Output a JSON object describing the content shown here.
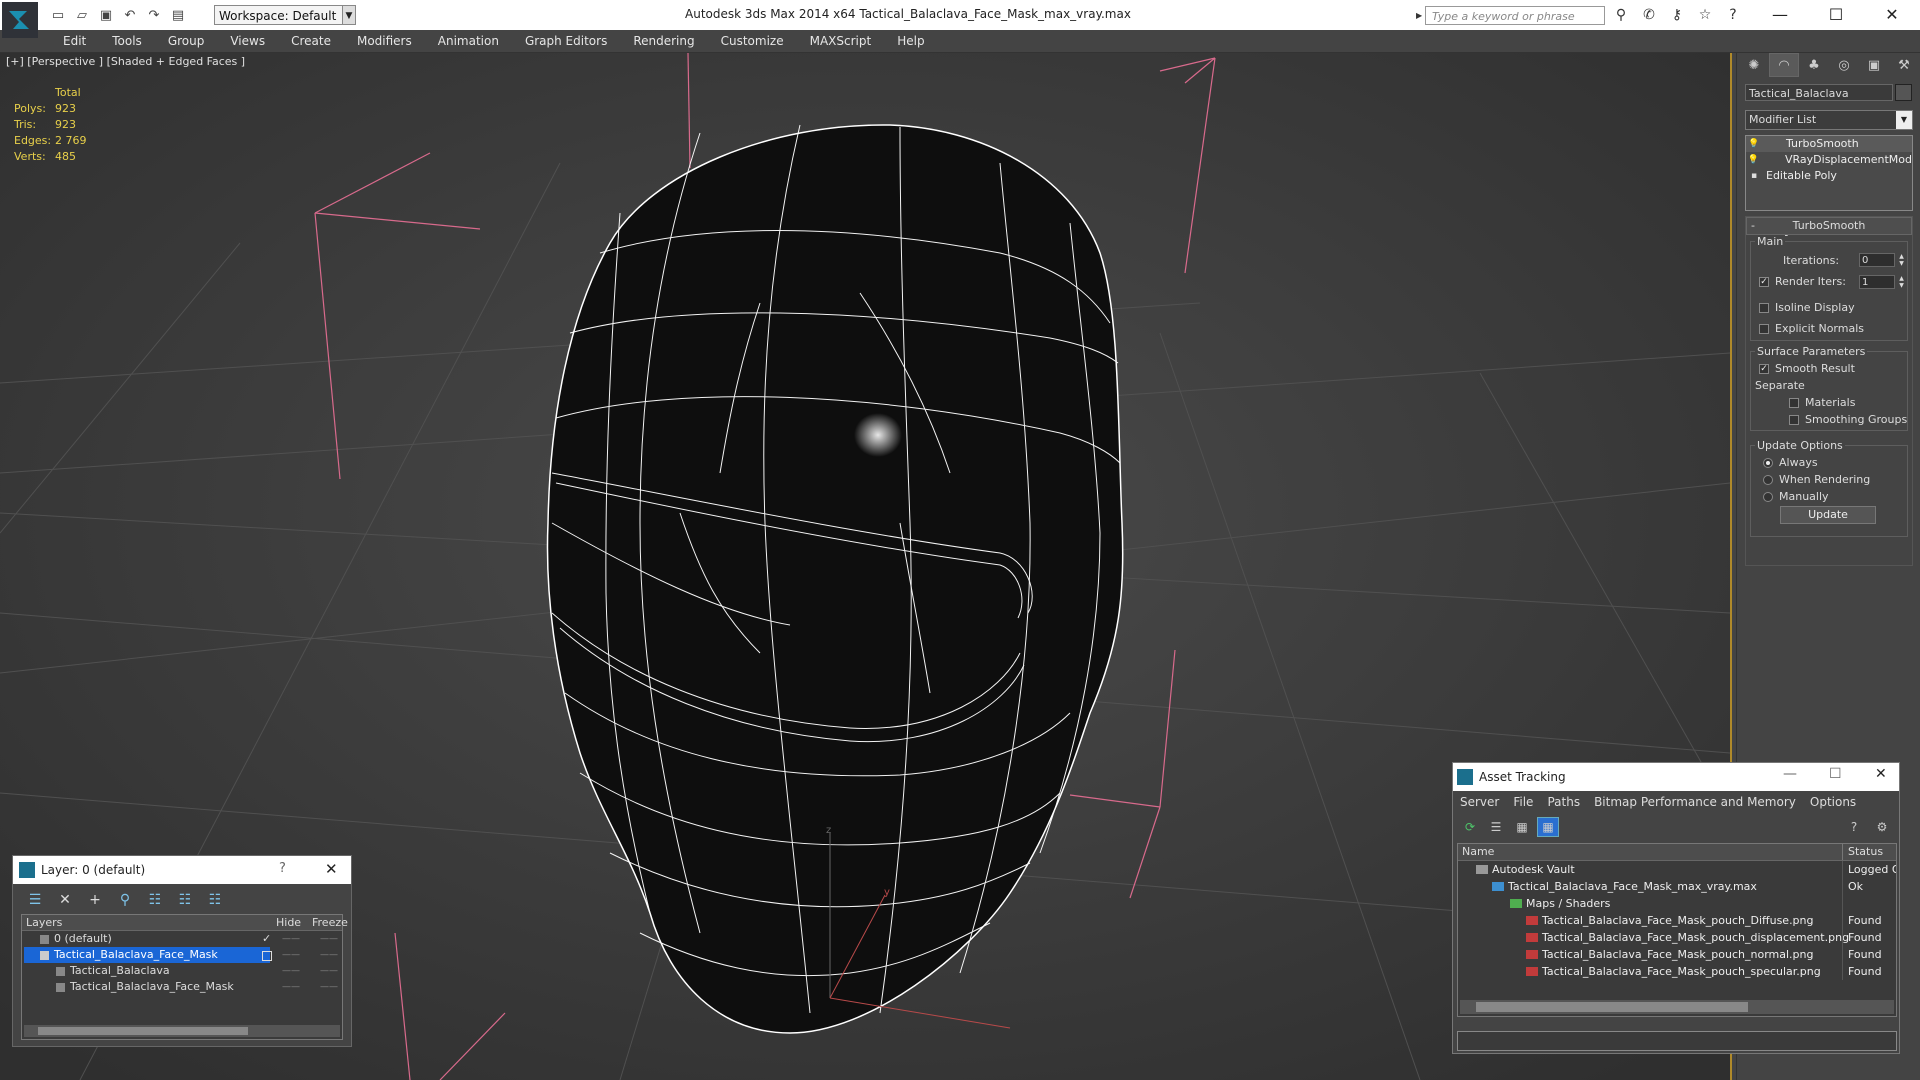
{
  "app": {
    "title": "Autodesk 3ds Max  2014 x64      Tactical_Balaclava_Face_Mask_max_vray.max",
    "workspace": "Workspace: Default",
    "search_placeholder": "Type a keyword or phrase",
    "accent": "#1b6f8d"
  },
  "menu": [
    "Edit",
    "Tools",
    "Group",
    "Views",
    "Create",
    "Modifiers",
    "Animation",
    "Graph Editors",
    "Rendering",
    "Customize",
    "MAXScript",
    "Help"
  ],
  "viewport": {
    "label": "[+] [Perspective ] [Shaded + Edged Faces ]",
    "stats": {
      "header": "Total",
      "rows": [
        {
          "k": "Polys:",
          "v": "923"
        },
        {
          "k": "Tris:",
          "v": "923"
        },
        {
          "k": "Edges:",
          "v": "2 769"
        },
        {
          "k": "Verts:",
          "v": "485"
        }
      ]
    }
  },
  "command_panel": {
    "object_name": "Tactical_Balaclava",
    "modifier_list": "Modifier List",
    "stack": [
      {
        "label": "TurboSmooth",
        "type": "sub"
      },
      {
        "label": "VRayDisplacementMod",
        "type": "sub"
      },
      {
        "label": "Editable Poly",
        "type": "base"
      }
    ],
    "rollout_title": "TurboSmooth",
    "main_group": "Main",
    "iterations_label": "Iterations:",
    "iterations_value": "0",
    "render_iters_label": "Render Iters:",
    "render_iters_value": "1",
    "isoline_label": "Isoline Display",
    "explicit_normals_label": "Explicit Normals",
    "surface_group": "Surface Parameters",
    "smooth_result_label": "Smooth Result",
    "separate_label": "Separate",
    "materials_label": "Materials",
    "smoothing_groups_label": "Smoothing Groups",
    "update_group": "Update Options",
    "always_label": "Always",
    "when_rendering_label": "When Rendering",
    "manually_label": "Manually",
    "update_button": "Update"
  },
  "layer_dialog": {
    "title": "Layer: 0 (default)",
    "help": "?",
    "columns": {
      "layers": "Layers",
      "hide": "Hide",
      "freeze": "Freeze"
    },
    "rows": [
      {
        "name": "0 (default)",
        "indent": 1,
        "selected": false,
        "check": "✓"
      },
      {
        "name": "Tactical_Balaclava_Face_Mask",
        "indent": 1,
        "selected": true,
        "check": ""
      },
      {
        "name": "Tactical_Balaclava",
        "indent": 2,
        "selected": false,
        "check": ""
      },
      {
        "name": "Tactical_Balaclava_Face_Mask",
        "indent": 2,
        "selected": false,
        "check": ""
      }
    ]
  },
  "asset_tracking": {
    "title": "Asset Tracking",
    "menu": [
      "Server",
      "File",
      "Paths",
      "Bitmap Performance and Memory",
      "Options"
    ],
    "columns": {
      "name": "Name",
      "status": "Status"
    },
    "rows": [
      {
        "name": "Autodesk Vault",
        "status": "Logged O",
        "indent": 1,
        "icon": "vault-icon"
      },
      {
        "name": "Tactical_Balaclava_Face_Mask_max_vray.max",
        "status": "Ok",
        "indent": 2,
        "icon": "max-file-icon"
      },
      {
        "name": "Maps / Shaders",
        "status": "",
        "indent": 3,
        "icon": "maps-icon"
      },
      {
        "name": "Tactical_Balaclava_Face_Mask_pouch_Diffuse.png",
        "status": "Found",
        "indent": 4,
        "icon": "png-icon"
      },
      {
        "name": "Tactical_Balaclava_Face_Mask_pouch_displacement.png",
        "status": "Found",
        "indent": 4,
        "icon": "png-icon"
      },
      {
        "name": "Tactical_Balaclava_Face_Mask_pouch_normal.png",
        "status": "Found",
        "indent": 4,
        "icon": "png-icon"
      },
      {
        "name": "Tactical_Balaclava_Face_Mask_pouch_specular.png",
        "status": "Found",
        "indent": 4,
        "icon": "png-icon"
      }
    ]
  }
}
